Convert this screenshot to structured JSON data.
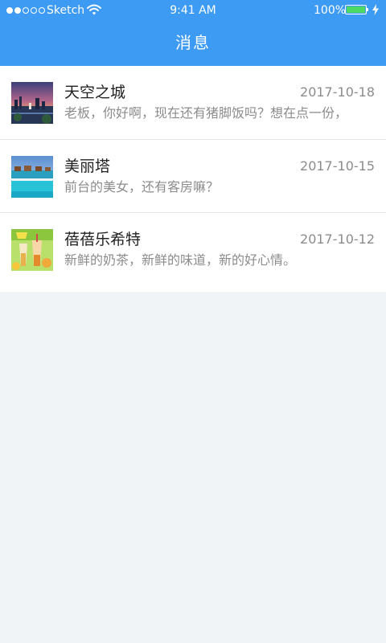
{
  "status_bar": {
    "carrier": "Sketch",
    "time": "9:41 AM",
    "battery": "100%",
    "signal_bars_filled": 2,
    "signal_bars_total": 5,
    "battery_level": 1.0
  },
  "header": {
    "title": "消息"
  },
  "messages": [
    {
      "name": "天空之城",
      "date": "2017-10-18",
      "preview": "老板，你好啊，现在还有猪脚饭吗？想在点一份，",
      "avatar_icon": "city-sunset-avatar"
    },
    {
      "name": "美丽塔",
      "date": "2017-10-15",
      "preview": "前台的美女，还有客房嘛？",
      "avatar_icon": "resort-pool-avatar"
    },
    {
      "name": "蓓蓓乐希特",
      "date": "2017-10-12",
      "preview": "新鲜的奶茶，新鲜的味道，新的好心情。",
      "avatar_icon": "milk-tea-avatar"
    }
  ],
  "colors": {
    "header_bg": "#3e9bf4",
    "page_bg": "#f1f4f7",
    "battery_fill": "#4cd964",
    "secondary_text": "#8c8c8c"
  }
}
